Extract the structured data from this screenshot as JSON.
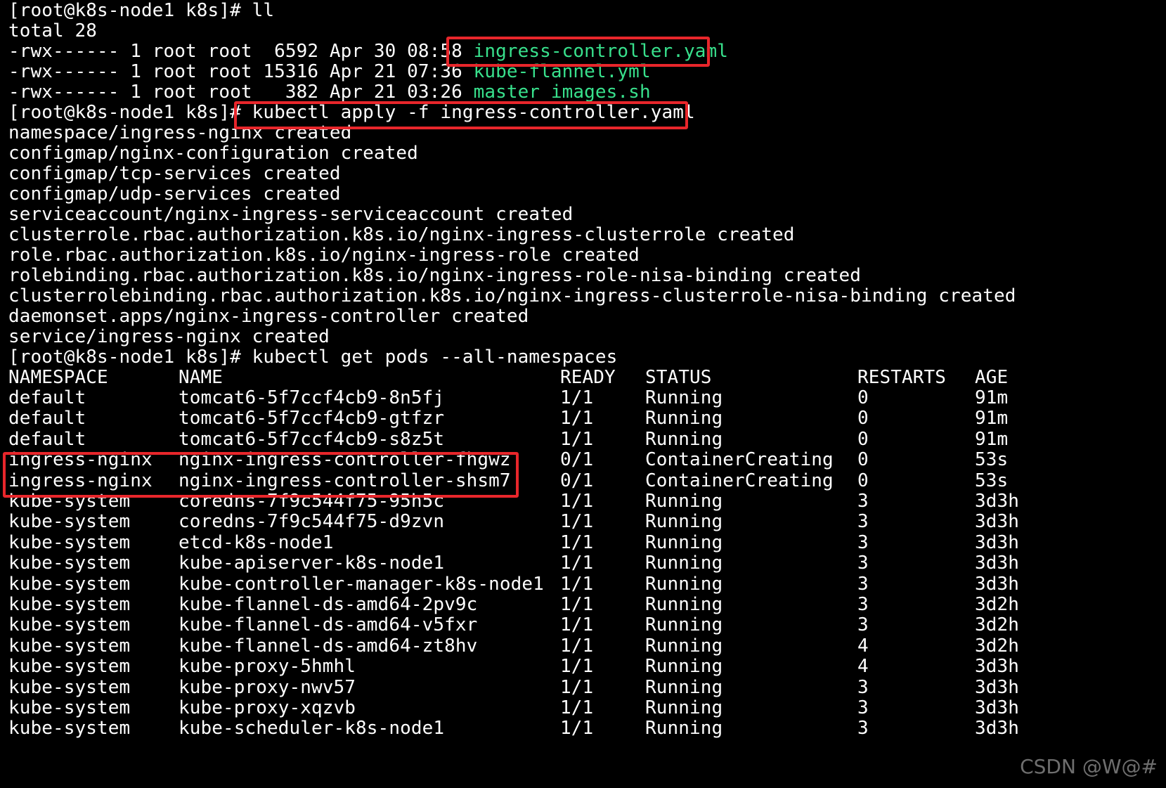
{
  "prompt": "[root@k8s-node1 k8s]# ",
  "ls": {
    "command": "ll",
    "total": "total 28",
    "files": [
      {
        "meta": "-rwx------ 1 root root  6592 Apr 30 08:58 ",
        "name": "ingress-controller.yaml"
      },
      {
        "meta": "-rwx------ 1 root root 15316 Apr 21 07:36 ",
        "name": "kube-flannel.yml"
      },
      {
        "meta": "-rwx------ 1 root root   382 Apr 21 03:26 ",
        "name": "master_images.sh"
      }
    ]
  },
  "apply": {
    "command": "kubectl apply -f ingress-controller.yaml",
    "output": [
      "namespace/ingress-nginx created",
      "configmap/nginx-configuration created",
      "configmap/tcp-services created",
      "configmap/udp-services created",
      "serviceaccount/nginx-ingress-serviceaccount created",
      "clusterrole.rbac.authorization.k8s.io/nginx-ingress-clusterrole created",
      "role.rbac.authorization.k8s.io/nginx-ingress-role created",
      "rolebinding.rbac.authorization.k8s.io/nginx-ingress-role-nisa-binding created",
      "clusterrolebinding.rbac.authorization.k8s.io/nginx-ingress-clusterrole-nisa-binding created",
      "daemonset.apps/nginx-ingress-controller created",
      "service/ingress-nginx created"
    ]
  },
  "get_pods": {
    "command": "kubectl get pods --all-namespaces",
    "headers": [
      "NAMESPACE",
      "NAME",
      "READY",
      "STATUS",
      "RESTARTS",
      "AGE"
    ],
    "rows": [
      [
        "default",
        "tomcat6-5f7ccf4cb9-8n5fj",
        "1/1",
        "Running",
        "0",
        "91m"
      ],
      [
        "default",
        "tomcat6-5f7ccf4cb9-gtfzr",
        "1/1",
        "Running",
        "0",
        "91m"
      ],
      [
        "default",
        "tomcat6-5f7ccf4cb9-s8z5t",
        "1/1",
        "Running",
        "0",
        "91m"
      ],
      [
        "ingress-nginx",
        "nginx-ingress-controller-fhgwz",
        "0/1",
        "ContainerCreating",
        "0",
        "53s"
      ],
      [
        "ingress-nginx",
        "nginx-ingress-controller-shsm7",
        "0/1",
        "ContainerCreating",
        "0",
        "53s"
      ],
      [
        "kube-system",
        "coredns-7f9c544f75-95h5c",
        "1/1",
        "Running",
        "3",
        "3d3h"
      ],
      [
        "kube-system",
        "coredns-7f9c544f75-d9zvn",
        "1/1",
        "Running",
        "3",
        "3d3h"
      ],
      [
        "kube-system",
        "etcd-k8s-node1",
        "1/1",
        "Running",
        "3",
        "3d3h"
      ],
      [
        "kube-system",
        "kube-apiserver-k8s-node1",
        "1/1",
        "Running",
        "3",
        "3d3h"
      ],
      [
        "kube-system",
        "kube-controller-manager-k8s-node1",
        "1/1",
        "Running",
        "3",
        "3d3h"
      ],
      [
        "kube-system",
        "kube-flannel-ds-amd64-2pv9c",
        "1/1",
        "Running",
        "3",
        "3d2h"
      ],
      [
        "kube-system",
        "kube-flannel-ds-amd64-v5fxr",
        "1/1",
        "Running",
        "3",
        "3d2h"
      ],
      [
        "kube-system",
        "kube-flannel-ds-amd64-zt8hv",
        "1/1",
        "Running",
        "4",
        "3d2h"
      ],
      [
        "kube-system",
        "kube-proxy-5hmhl",
        "1/1",
        "Running",
        "4",
        "3d3h"
      ],
      [
        "kube-system",
        "kube-proxy-nwv57",
        "1/1",
        "Running",
        "3",
        "3d3h"
      ],
      [
        "kube-system",
        "kube-proxy-xqzvb",
        "1/1",
        "Running",
        "3",
        "3d3h"
      ],
      [
        "kube-system",
        "kube-scheduler-k8s-node1",
        "1/1",
        "Running",
        "3",
        "3d3h"
      ]
    ]
  },
  "watermark": "CSDN @W@#",
  "colors": {
    "background": "#000000",
    "text": "#ffffff",
    "file_highlight": "#38e08c",
    "annotation_box": "#e8262b"
  }
}
